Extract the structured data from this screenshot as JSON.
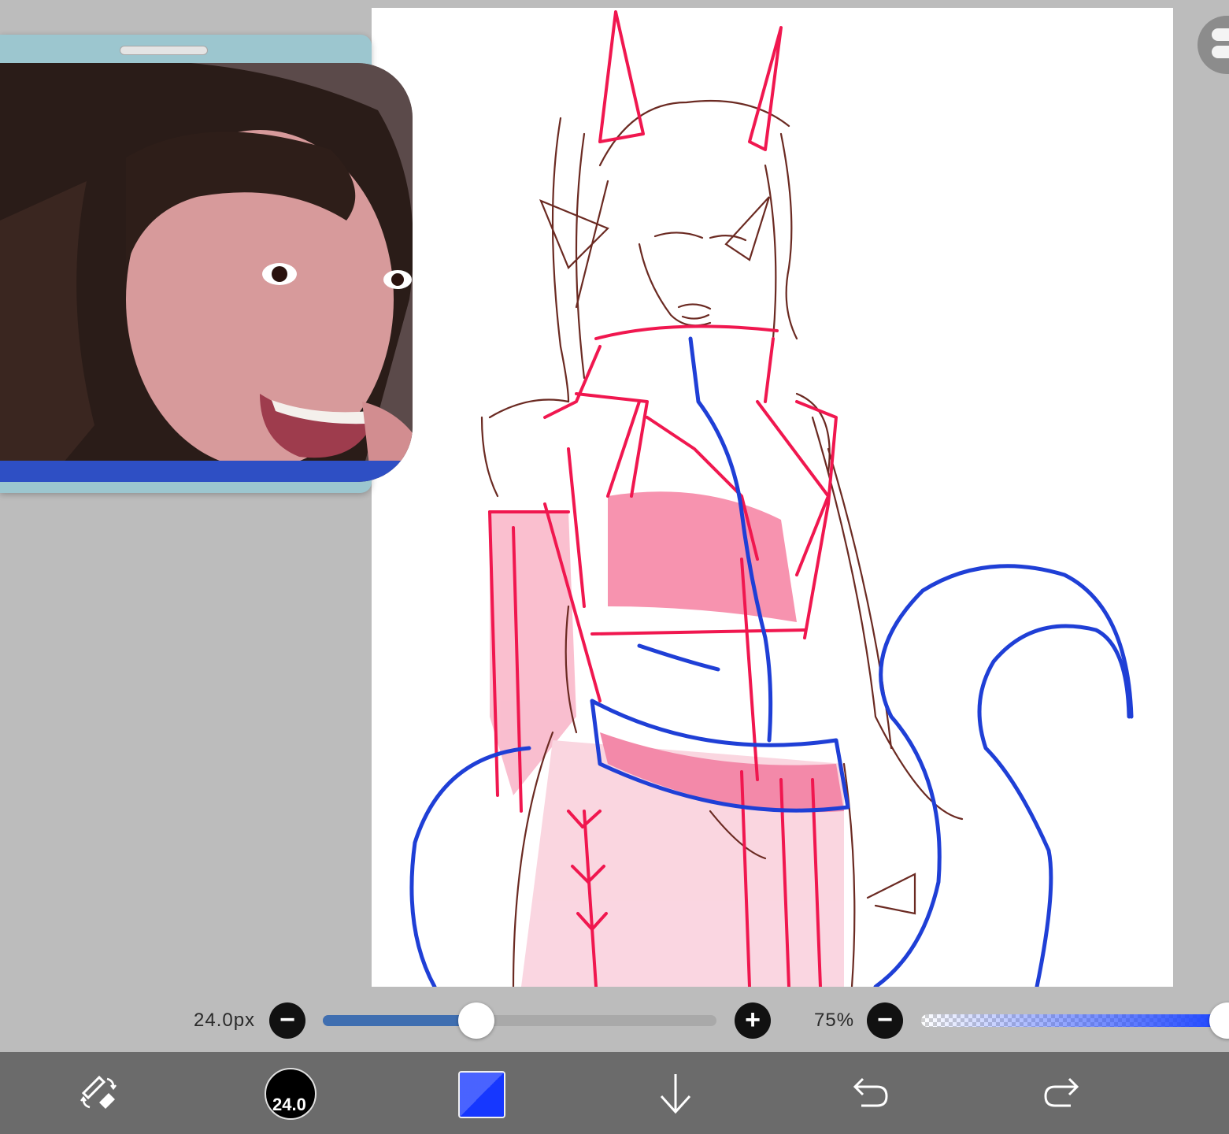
{
  "brush": {
    "size_label": "24.0px",
    "size_fraction": 0.39,
    "opacity_label": "75%",
    "opacity_fraction": 1.0,
    "minus_glyph": "−",
    "plus_glyph": "+"
  },
  "toolbar": {
    "brush_preview_label": "24.0",
    "current_color": "#1637ff",
    "icons": [
      "brush-eraser-swap-icon",
      "brush-size-preview",
      "color-swatch",
      "layer-down-arrow-icon",
      "undo-icon",
      "redo-icon"
    ]
  },
  "colors": {
    "sketch_red": "#f0174f",
    "sketch_blue": "#1f3fd6",
    "sketch_brown": "#6b2a22",
    "workspace_gray": "#bcbcbc",
    "toolbar_gray": "#6b6b6b"
  }
}
